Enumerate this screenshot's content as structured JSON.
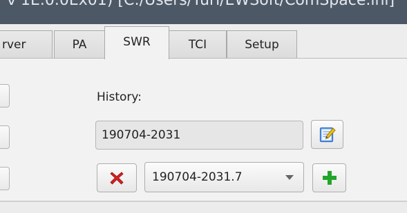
{
  "window": {
    "title": "v 1E.0.0Ex01) [C:/Users/Yuri/EWSoft/ComSpace.ini]"
  },
  "tabs": [
    {
      "label": "rver"
    },
    {
      "label": "PA"
    },
    {
      "label": "SWR",
      "active": true
    },
    {
      "label": "TCI"
    },
    {
      "label": "Setup"
    }
  ],
  "history": {
    "label": "History:",
    "field_value": "190704-2031",
    "selected": "190704-2031.7"
  },
  "colors": {
    "title_bar": "#4d5866",
    "delete_icon": "#d92020",
    "add_icon": "#22a52a",
    "edit_icon": "#3f76d2"
  },
  "icons": {
    "edit": "edit-note-icon",
    "delete": "red-x-icon",
    "add": "green-plus-icon",
    "combo": "dropdown-arrow-icon"
  }
}
